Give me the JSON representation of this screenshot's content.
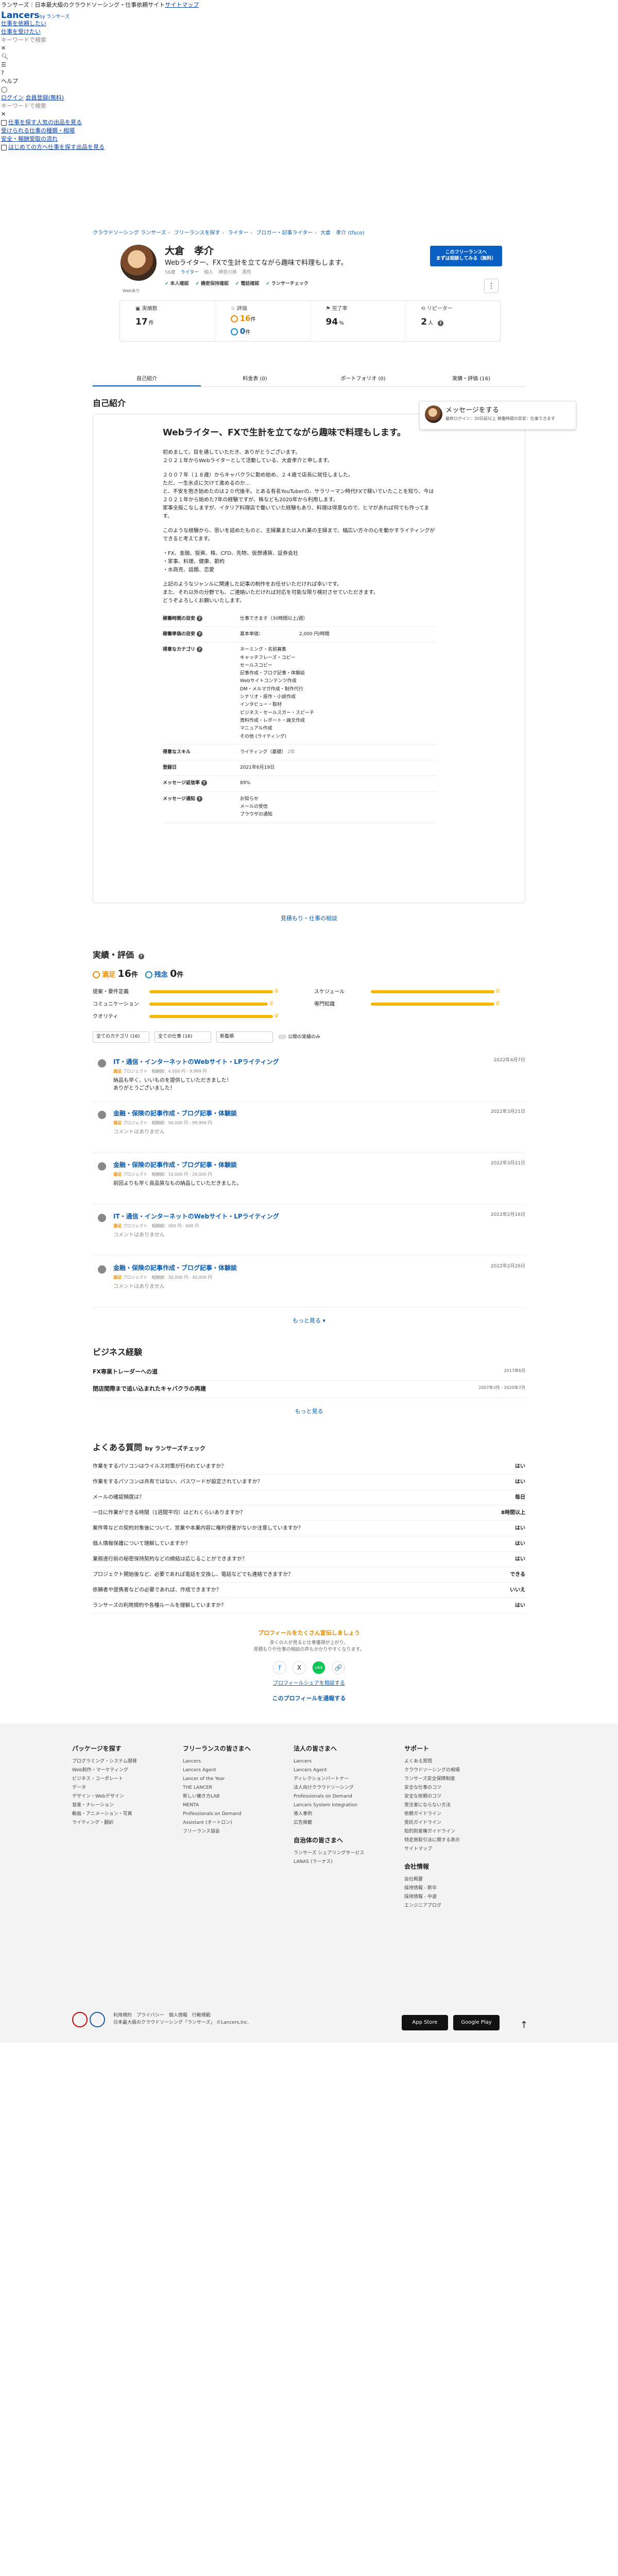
{
  "top": {
    "brand_line": "ランサーズ｜日本最大級のクラウドソーシング・仕事依頼サイト",
    "brand_link": "サイトマップ",
    "logo": "Lancers",
    "logo_sub": "by ランサーズ",
    "links": [
      "仕事を依頼したい",
      "仕事を受けたい"
    ],
    "search_placeholder": "キーワードで検索",
    "help": "ヘルプ",
    "login": "ログイン",
    "register": "会員登録(無料)",
    "search2": "キーワードで検索",
    "menu": [
      "仕事を探す",
      "人気の出品を見る",
      "受けられる仕事の種類・相場",
      "安全・報酬受取の流れ",
      "はじめての方へ仕事を探す",
      "出品を見る"
    ]
  },
  "breadcrumb": [
    "クラウドソーシング ランサーズ",
    "フリーランスを探す",
    "ライター",
    "ブロガー・記事ライター",
    "大倉　孝介 (tfsco)"
  ],
  "profile": {
    "name": "大倉　孝介",
    "catch": "Webライター、FXで生計を立てながら趣味で料理もします。",
    "meta": [
      "56歳",
      "ライター",
      "個人",
      "神奈川県",
      "男性"
    ],
    "badges": [
      "本人確認",
      "機密保持確認",
      "電話確認",
      "ランサーチェック"
    ],
    "status": "Webあり",
    "cta": "このフリーランスへ\nまずは相談してみる（無料）",
    "more": "⋮",
    "stats": {
      "jobs_label": "実績数",
      "jobs_value": "17",
      "jobs_unit": "件",
      "rating_label": "評価",
      "good": "16",
      "bad": "0",
      "rating_unit": "件",
      "completion_label": "完了率",
      "completion_value": "94",
      "completion_unit": "%",
      "repeat_label": "リピーター",
      "repeat_value": "2",
      "repeat_unit": "人"
    }
  },
  "tabs": [
    "自己紹介",
    "料金表 (0)",
    "ポートフォリオ (0)",
    "実績・評価 (16)"
  ],
  "intro": {
    "heading": "自己紹介",
    "message_title": "メッセージをする",
    "message_sub": "最終ログイン：30日前以上  稼働時間の目安：仕事できます",
    "catch": "Webライター、FXで生計を立てながら趣味で料理もします。",
    "paras": [
      "初めまして。目を通していただき、ありがとうございます。\n２０２１年からWebライターとして活動している、大倉孝介と申します。",
      "２００７年（１８歳）からキャバクラに勤め始め、２４歳で店長に就任しました。\nただ、一生氷点に欠けて進めるのか…\nと、不安を抱き始めたのは２０代後半。とある有名YouTuberの、サラリーマン時代FXで稼いでいたことを知り、今は２０２１年から始めた7年の経験ですが、株なども2020年から利用します。\n家事全般こなしますが、イタリア料理店で働いていた経験もあり、料理は得意なので、ヒマがあれば何でも作ってます。",
      "このような経験から、思いを詰めたものと、主婦業または入れ業の主婦まで、幅広い方々の心を動かすライティングができると考えてます。",
      "・FX、金融、投資、株、CFD、先物、仮想通貨、証券会社\n・家事、料理、健康、節約\n・水商売、話題、恋愛",
      "上記のようなジャンルに関連した記事の制作をお任せいただければ幸いです。\nまた、それ以外の分野でも、ご連絡いただければ対応を可能な限り検討させていただきます。\nどうぞよろしくお願いいたします。"
    ],
    "rows": [
      {
        "k": "稼働時間の目安",
        "v": "仕事できます（30時間以上/週）"
      },
      {
        "k": "稼働単価の目安",
        "v": "基本単価：",
        "v2": "2,000 円/時間"
      },
      {
        "k": "得意なカテゴリ",
        "v": "ネーミング・名前募集\nキャッチフレーズ・コピー\nセールスコピー\n記事作成・ブログ記事・体験談\nWebサイトコンテンツ作成\nDM・メルマガ作成・制作代行\nシナリオ・原作・小説作成\nインタビュー・取材\nビジネス・セールスガー・スピーチ\n資料作成・レポート・論文作成\nマニュアル作成\nその他 (ライティング)"
      },
      {
        "k": "得意なスキル",
        "v": "ライティング（基礎）",
        "v2": "2年"
      },
      {
        "k": "登録日",
        "v": "2021年6月19日"
      },
      {
        "k": "メッセージ返信率",
        "v": "89%"
      },
      {
        "k": "メッセージ通知",
        "v": "お知らせ\nメールの受信\nブラウザの通知"
      }
    ],
    "see_all": "見積もり・仕事の相談"
  },
  "reviews": {
    "heading": "実績・評価",
    "good_label": "満足",
    "good": "16",
    "bad_label": "残念",
    "bad": "0",
    "unit": "件",
    "bars": [
      {
        "label": "提案・要件定義",
        "value": 1.0
      },
      {
        "label": "スケジュール",
        "value": 1.0
      },
      {
        "label": "コミュニケーション",
        "value": 0.96
      },
      {
        "label": "専門知識",
        "value": 1.0
      },
      {
        "label": "クオリティ",
        "value": 1.0
      }
    ],
    "filters": [
      "全てのカテゴリ (16)",
      "全ての仕事 (16)",
      "新着順"
    ],
    "toggle": "公開の実績のみ",
    "items": [
      {
        "title": "IT・通信・インターネットのWebサイト・LPライティング",
        "date": "2022年4月7日",
        "meta_good": "満足",
        "meta": "プロジェクト　報酬額：4,000 円 - 9,999 円",
        "comment": "納品も早く、いいものを提供していただきました！\nありがとうございました！"
      },
      {
        "title": "金融・保険の記事作成・ブログ記事・体験談",
        "date": "2022年3月21日",
        "meta_good": "満足",
        "meta": "プロジェクト　報酬額：50,000 円 - 99,999 円",
        "comment": "コメントはありません"
      },
      {
        "title": "金融・保険の記事作成・ブログ記事・体験談",
        "date": "2022年3月21日",
        "meta_good": "満足",
        "meta": "プロジェクト　報酬額：10,000 円 - 20,000 円",
        "comment": "前回よりも早く良品質なもの納品していただきました。"
      },
      {
        "title": "IT・通信・インターネットのWebサイト・LPライティング",
        "date": "2022年2月16日",
        "meta_good": "満足",
        "meta": "プロジェクト　報酬額：300 円 - 600 円",
        "comment": "コメントはありません"
      },
      {
        "title": "金融・保険の記事作成・ブログ記事・体験談",
        "date": "2022年2月26日",
        "meta_good": "満足",
        "meta": "プロジェクト　報酬額：30,000 円 - 40,000 円",
        "comment": "コメントはありません"
      }
    ],
    "more": "もっと見る ▾"
  },
  "business": {
    "heading": "ビジネス経験",
    "items": [
      {
        "t": "FX専業トレーダーへの道",
        "d": "2017年6月"
      },
      {
        "t": "閉店間際まで追い込まれたキャバクラの再建",
        "d": "2007年3月 - 2020年7月"
      }
    ],
    "more": "もっと見る"
  },
  "faq": {
    "heading": "よくある質問",
    "by": "by ランサーズチェック",
    "items": [
      {
        "q": "作業をするパソコンはウイルス対策が行われていますか？",
        "a": "はい"
      },
      {
        "q": "作業をするパソコンは共有ではない、パスワードが設定されていますか？",
        "a": "はい"
      },
      {
        "q": "メールの確認頻度は？",
        "a": "毎日"
      },
      {
        "q": "一日に作業ができる時間（1週間平均）はどれくらいありますか？",
        "a": "8時間以上"
      },
      {
        "q": "案件等などの契約対象後について、営業や本業内容に権利侵害がないか注意していますか？",
        "a": "はい"
      },
      {
        "q": "個人情報保護について理解していますか？",
        "a": "はい"
      },
      {
        "q": "業務遂行前の秘密保持契約などの締結は応じることができますか？",
        "a": "はい"
      },
      {
        "q": "プロジェクト開始後など、必要であれば電話を交換し、電話などでも連絡できますか？",
        "a": "できる"
      },
      {
        "q": "依頼者や提携者などの必要であれば、作成できますか？",
        "a": "いいえ"
      },
      {
        "q": "ランサーズの利用規約や各種ルールを理解していますか？",
        "a": "はい"
      }
    ]
  },
  "share": {
    "t1": "プロフィールをたくさん宣伝しましょう",
    "t2": "多くの人が見ると仕事獲得が上がり、\n見積もりや仕事の相談の声もかかりやすくなります。",
    "icons": [
      "f",
      "X",
      "LINE",
      "🔗"
    ],
    "link1": "プロフィールシェアを相談する",
    "link2": "このプロフィールを通報する"
  },
  "footer": {
    "cols": [
      {
        "h": "パッケージを探す",
        "items": [
          "プログラミング・システム開発",
          "Web制作・マーケティング",
          "ビジネス・コーポレート",
          "データ",
          "デザイン・Webデザイン",
          "音楽・ナレーション",
          "動画・アニメーション・写真",
          "ライティング・翻訳"
        ]
      },
      {
        "h": "フリーランスの皆さまへ",
        "items": [
          "Lancers",
          "Lancers Agent",
          "Lancer of the Year",
          "THE LANCER",
          "新しい働き方LAB",
          "MENTA",
          "Professionals on Demand",
          "Assistant (オートロン)",
          "フリーランス協会"
        ]
      },
      {
        "h": "法人の皆さまへ",
        "items": [
          "Lancers",
          "Lancers Agent",
          "ディレクションパートナー",
          "法人向けクラウドソーシング",
          "Professionals on Demand",
          "Lancers System Integration",
          "導入事例",
          "広告掲載"
        ],
        "h2": "自治体の皆さまへ",
        "items2": [
          "ランサーズ シェアリングサービス",
          "LANAS (ラーナス)"
        ]
      },
      {
        "h": "サポート",
        "items": [
          "よくある質問",
          "クラウドソーシングの相場",
          "ランサーズ安全保障制度",
          "安全な仕事のコツ",
          "安全な依頼のコツ",
          "受注者にならない方法",
          "依頼ガイドライン",
          "受託ガイドライン",
          "知的財産権ガイドライン",
          "特定商取引法に関する表示",
          "サイトマップ"
        ],
        "h2": "会社情報",
        "items2": [
          "会社概要",
          "採用情報 - 新卒",
          "採用情報 - 中途",
          "エンジニアブログ"
        ]
      }
    ],
    "bottom": "利用規約　プライバシー　個人情報　行動規範\n日本最大級のクラウドソーシング「ランサーズ」 ©Lancers,Inc.",
    "appstore": "App Store",
    "googleplay": "Google Play"
  }
}
